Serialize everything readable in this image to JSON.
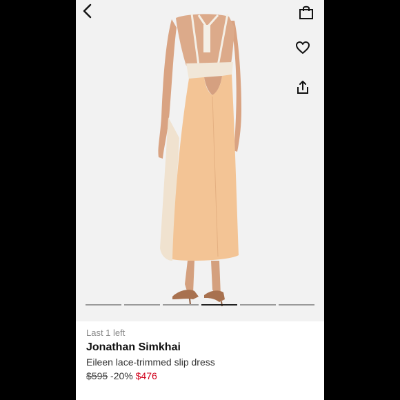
{
  "product": {
    "stock_note": "Last 1 left",
    "brand": "Jonathan Simkhai",
    "name": "Eileen lace-trimmed slip dress",
    "original_price": "$595",
    "discount": "-20%",
    "sale_price": "$476"
  },
  "gallery": {
    "image_count": 6,
    "active_index": 3
  },
  "icons": {
    "back": "chevron-left-icon",
    "bag": "shopping-bag-icon",
    "wishlist": "heart-icon",
    "share": "share-icon"
  },
  "colors": {
    "sale": "#d0021b",
    "dress": "#f3c495",
    "panel": "#f0e2cf"
  }
}
